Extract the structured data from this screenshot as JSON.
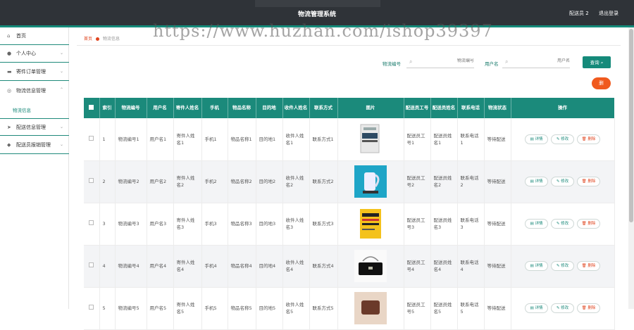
{
  "header": {
    "title": "物流管理系统",
    "user": "配送员 2",
    "logout": "退出登录"
  },
  "watermark": "https://www.huzhan.com/ishop39397",
  "sidebar": {
    "items": [
      {
        "label": "首页",
        "icon": "home-icon"
      },
      {
        "label": "个人中心",
        "icon": "user-icon"
      },
      {
        "label": "寄件订单管理",
        "icon": "order-icon"
      },
      {
        "label": "物流信息管理",
        "icon": "logistics-icon"
      },
      {
        "label": "配送信息管理",
        "icon": "send-icon"
      },
      {
        "label": "配送员报销管理",
        "icon": "shield-icon"
      }
    ],
    "sub_item": "物流信息"
  },
  "breadcrumb": {
    "home": "首页",
    "current": "物流信息"
  },
  "search": {
    "field1_label": "物流编号",
    "field1_placeholder": "物流编号",
    "field2_label": "用户名",
    "field2_placeholder": "用户名",
    "button": "查询"
  },
  "delete_button": "删",
  "table": {
    "headers": [
      "",
      "索引",
      "物流编号",
      "用户名",
      "寄件人姓名",
      "手机",
      "物品名称",
      "目的地",
      "收件人姓名",
      "联系方式",
      "图片",
      "配送员工号",
      "配送员姓名",
      "联系电话",
      "物流状态",
      "操作"
    ],
    "action_labels": {
      "detail": "详情",
      "edit": "修改",
      "delete": "删除"
    },
    "rows": [
      {
        "idx": "1",
        "no": "物流编号1",
        "user": "用户名1",
        "sender": "寄件人姓名1",
        "phone": "手机1",
        "item": "物品名称1",
        "dest": "目的地1",
        "receiver": "收件人姓名1",
        "contact": "联系方式1",
        "image": "book-image",
        "staff_no": "配送员工号1",
        "staff_name": "配送员姓名1",
        "tel": "联系电话1",
        "status": "等待配送"
      },
      {
        "idx": "2",
        "no": "物流编号2",
        "user": "用户名2",
        "sender": "寄件人姓名2",
        "phone": "手机2",
        "item": "物品名称2",
        "dest": "目的地2",
        "receiver": "收件人姓名2",
        "contact": "联系方式2",
        "image": "kettle-image",
        "staff_no": "配送员工号2",
        "staff_name": "配送员姓名2",
        "tel": "联系电话2",
        "status": "等待配送"
      },
      {
        "idx": "3",
        "no": "物流编号3",
        "user": "用户名3",
        "sender": "寄件人姓名3",
        "phone": "手机3",
        "item": "物品名称3",
        "dest": "目的地3",
        "receiver": "收件人姓名3",
        "contact": "联系方式3",
        "image": "yellow-book-image",
        "staff_no": "配送员工号3",
        "staff_name": "配送员姓名3",
        "tel": "联系电话3",
        "status": "等待配送"
      },
      {
        "idx": "4",
        "no": "物流编号4",
        "user": "用户名4",
        "sender": "寄件人姓名4",
        "phone": "手机4",
        "item": "物品名称4",
        "dest": "目的地4",
        "receiver": "收件人姓名4",
        "contact": "联系方式4",
        "image": "handbag-image",
        "staff_no": "配送员工号4",
        "staff_name": "配送员姓名4",
        "tel": "联系电话4",
        "status": "等待配送"
      },
      {
        "idx": "5",
        "no": "物流编号5",
        "user": "用户名5",
        "sender": "寄件人姓名5",
        "phone": "手机5",
        "item": "物品名称5",
        "dest": "目的地5",
        "receiver": "收件人姓名5",
        "contact": "联系方式5",
        "image": "brown-bag-image",
        "staff_no": "配送员工号5",
        "staff_name": "配送员姓名5",
        "tel": "联系电话5",
        "status": "等待配送"
      }
    ]
  },
  "colors": {
    "accent": "#1b8a7b",
    "danger": "#f05a1e",
    "topbar": "#2f3338"
  }
}
